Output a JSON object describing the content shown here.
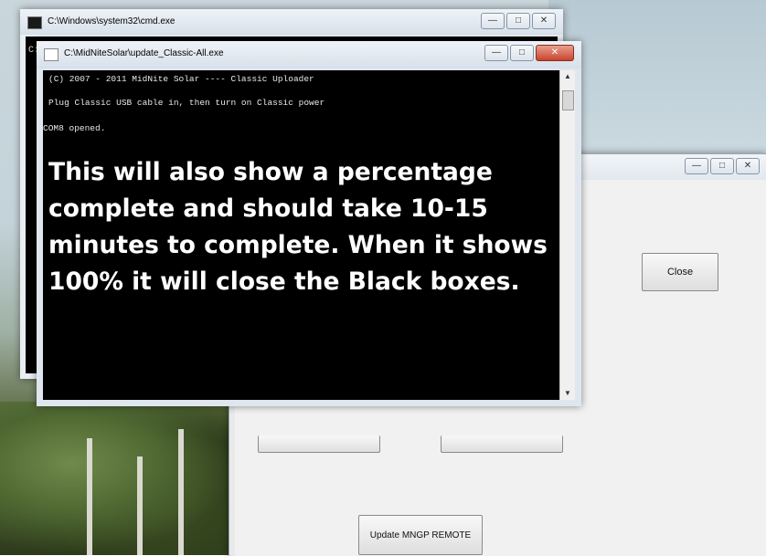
{
  "back_window": {
    "title": "C:\\Windows\\system32\\cmd.exe",
    "prompt": "C:"
  },
  "front_window": {
    "title": "C:\\MidNiteSolar\\update_Classic-All.exe",
    "console_lines": [
      "(C) 2007 - 2011 MidNite Solar  ----  Classic Uploader",
      "Plug Classic USB cable in, then turn on Classic power",
      "COM8 opened."
    ],
    "overlay_lines": [
      "This will also show a percentage",
      "complete and should take 10-15",
      "minutes to complete. When it shows",
      "100% it will close the Black boxes."
    ]
  },
  "app_window": {
    "close_label": "Close",
    "update_label": "Update MNGP REMOTE"
  }
}
